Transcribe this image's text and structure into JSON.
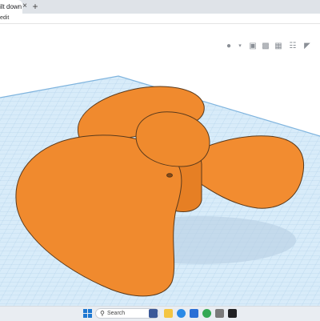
{
  "browser": {
    "tab_title": "ilt down - T",
    "tab_close_glyph": "×",
    "new_tab_glyph": "+",
    "address_text": "edit"
  },
  "toolbar": {
    "icons": [
      "lightbulb-icon",
      "dropdown-caret-icon",
      "workplane-icon",
      "group-icon",
      "ungroup-icon",
      "align-icon",
      "mirror-icon"
    ],
    "caret_glyph": "▾"
  },
  "scene": {
    "object": "propeller",
    "object_color": "#f28a30",
    "object_shadow_color": "#e07a22",
    "workplane_color": "#cfe6f7",
    "grid_color": "#a9cbe6"
  },
  "taskbar": {
    "search_placeholder": "Search",
    "app_icons": [
      "edge-browser-icon",
      "file-explorer-icon",
      "store-icon",
      "chrome-icon",
      "terminal-icon",
      "photos-icon"
    ]
  }
}
